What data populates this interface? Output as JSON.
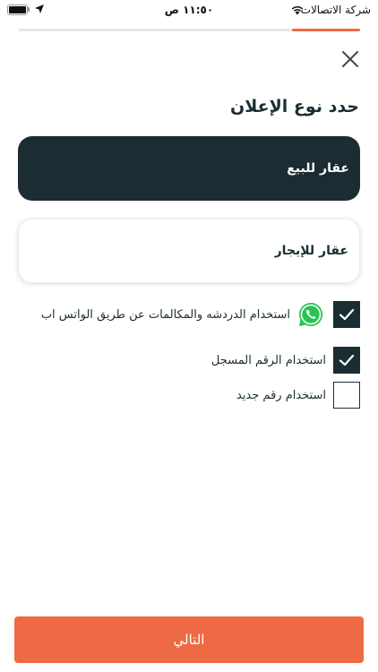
{
  "status_bar": {
    "carrier": "شركة الاتصالات",
    "time": "١١:٥٠ ص"
  },
  "progress": {
    "fraction": 0.2
  },
  "page": {
    "title": "حدد نوع الإعلان"
  },
  "options": {
    "sale_label": "عقار للبيع",
    "rent_label": "عقار للإيجار",
    "selected": "sale"
  },
  "checkboxes": {
    "whatsapp_label": "استخدام الدردشه والمكالمات عن طريق الواتس اب",
    "whatsapp_checked": true,
    "registered_label": "استخدام الرقم المسجل",
    "registered_checked": true,
    "new_number_label": "استخدام رقم جديد",
    "new_number_checked": false
  },
  "footer": {
    "next_label": "التالي"
  },
  "colors": {
    "accent": "#ee6a45",
    "dark": "#1b2d32"
  }
}
